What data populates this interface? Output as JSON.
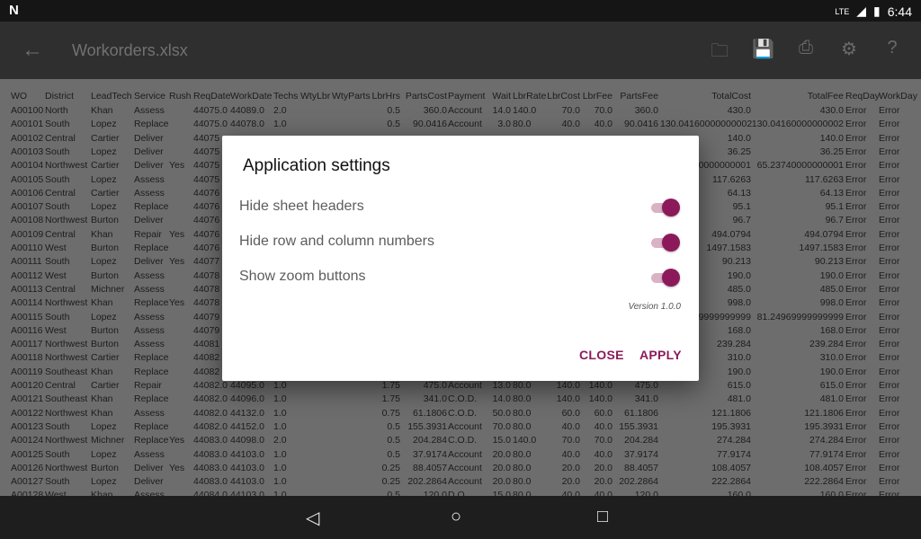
{
  "status_bar": {
    "time": "6:44",
    "network": "LTE",
    "notification_icon": "n-icon"
  },
  "app_bar": {
    "title": "Workorders.xlsx",
    "icons": [
      "back-arrow-icon",
      "folder-icon",
      "save-icon",
      "print-icon",
      "gear-icon",
      "help-icon"
    ]
  },
  "sheet": {
    "columns": [
      "WO",
      "District",
      "LeadTech",
      "Service",
      "Rush",
      "ReqDate",
      "WorkDate",
      "Techs",
      "WtyLbr",
      "WtyParts",
      "LbrHrs",
      "PartsCost",
      "Payment",
      "Wait",
      "LbrRate",
      "LbrCost",
      "LbrFee",
      "PartsFee",
      "TotalCost",
      "TotalFee",
      "ReqDay",
      "WorkDay"
    ],
    "rows": [
      [
        "A00100",
        "North",
        "Khan",
        "Assess",
        "",
        "44075.0",
        "44089.0",
        "2.0",
        "",
        "",
        "0.5",
        "360.0",
        "Account",
        "14.0",
        "140.0",
        "70.0",
        "70.0",
        "360.0",
        "430.0",
        "430.0",
        "Error",
        "Error"
      ],
      [
        "A00101",
        "South",
        "Lopez",
        "Replace",
        "",
        "44075.0",
        "44078.0",
        "1.0",
        "",
        "",
        "0.5",
        "90.0416",
        "Account",
        "3.0",
        "80.0",
        "40.0",
        "40.0",
        "90.0416",
        "130.04160000000002",
        "130.04160000000002",
        "Error",
        "Error"
      ],
      [
        "A00102",
        "Central",
        "Cartier",
        "Deliver",
        "",
        "44075",
        "",
        "",
        "",
        "",
        "",
        "",
        "",
        "",
        "",
        "",
        "",
        "",
        "140.0",
        "140.0",
        "Error",
        "Error"
      ],
      [
        "A00103",
        "South",
        "Lopez",
        "Deliver",
        "",
        "44075",
        "",
        "",
        "",
        "",
        "",
        "",
        "",
        "",
        "",
        "",
        "",
        "",
        "36.25",
        "36.25",
        "Error",
        "Error"
      ],
      [
        "A00104",
        "Northwest",
        "Cartier",
        "Deliver",
        "Yes",
        "44075",
        "",
        "",
        "",
        "",
        "",
        "",
        "",
        "",
        "",
        "",
        "",
        "",
        "65.23740000000001",
        "65.23740000000001",
        "Error",
        "Error"
      ],
      [
        "A00105",
        "South",
        "Lopez",
        "Assess",
        "",
        "44075",
        "",
        "",
        "",
        "",
        "",
        "",
        "",
        "",
        "",
        "",
        "",
        "",
        "117.6263",
        "117.6263",
        "Error",
        "Error"
      ],
      [
        "A00106",
        "Central",
        "Cartier",
        "Assess",
        "",
        "44076",
        "",
        "",
        "",
        "",
        "",
        "",
        "",
        "",
        "",
        "",
        "",
        "",
        "64.13",
        "64.13",
        "Error",
        "Error"
      ],
      [
        "A00107",
        "South",
        "Lopez",
        "Replace",
        "",
        "44076",
        "",
        "",
        "",
        "",
        "",
        "",
        "",
        "",
        "",
        "",
        "",
        "",
        "95.1",
        "95.1",
        "Error",
        "Error"
      ],
      [
        "A00108",
        "Northwest",
        "Burton",
        "Deliver",
        "",
        "44076",
        "",
        "",
        "",
        "",
        "",
        "",
        "",
        "",
        "",
        "",
        "",
        "",
        "96.7",
        "96.7",
        "Error",
        "Error"
      ],
      [
        "A00109",
        "Central",
        "Khan",
        "Repair",
        "Yes",
        "44076",
        "",
        "",
        "",
        "",
        "",
        "",
        "",
        "",
        "",
        "",
        "",
        "",
        "494.0794",
        "494.0794",
        "Error",
        "Error"
      ],
      [
        "A00110",
        "West",
        "Burton",
        "Replace",
        "",
        "44076",
        "",
        "",
        "",
        "",
        "",
        "",
        "",
        "",
        "",
        "",
        "",
        "",
        "1497.1583",
        "1497.1583",
        "Error",
        "Error"
      ],
      [
        "A00111",
        "South",
        "Lopez",
        "Deliver",
        "Yes",
        "44077",
        "",
        "",
        "",
        "",
        "",
        "",
        "",
        "",
        "",
        "",
        "",
        "",
        "90.213",
        "90.213",
        "Error",
        "Error"
      ],
      [
        "A00112",
        "West",
        "Burton",
        "Assess",
        "",
        "44078",
        "",
        "",
        "",
        "",
        "",
        "",
        "",
        "",
        "",
        "",
        "",
        "",
        "190.0",
        "190.0",
        "Error",
        "Error"
      ],
      [
        "A00113",
        "Central",
        "Michner",
        "Assess",
        "",
        "44078",
        "",
        "",
        "",
        "",
        "",
        "",
        "",
        "",
        "",
        "",
        "",
        "",
        "485.0",
        "485.0",
        "Error",
        "Error"
      ],
      [
        "A00114",
        "Northwest",
        "Khan",
        "Replace",
        "Yes",
        "44078",
        "",
        "",
        "",
        "",
        "",
        "",
        "",
        "",
        "",
        "",
        "",
        "",
        "998.0",
        "998.0",
        "Error",
        "Error"
      ],
      [
        "A00115",
        "South",
        "Lopez",
        "Assess",
        "",
        "44079",
        "",
        "",
        "",
        "",
        "",
        "",
        "",
        "",
        "",
        "",
        "",
        "",
        "81.24969999999999",
        "81.24969999999999",
        "Error",
        "Error"
      ],
      [
        "A00116",
        "West",
        "Burton",
        "Assess",
        "",
        "44079",
        "",
        "",
        "",
        "",
        "",
        "",
        "",
        "",
        "",
        "",
        "",
        "",
        "168.0",
        "168.0",
        "Error",
        "Error"
      ],
      [
        "A00117",
        "Northwest",
        "Burton",
        "Assess",
        "",
        "44081",
        "",
        "",
        "",
        "",
        "",
        "",
        "",
        "",
        "",
        "",
        "",
        "",
        "239.284",
        "239.284",
        "Error",
        "Error"
      ],
      [
        "A00118",
        "Northwest",
        "Cartier",
        "Replace",
        "",
        "44082",
        "",
        "",
        "",
        "",
        "",
        "",
        "",
        "",
        "",
        "",
        "",
        "",
        "310.0",
        "310.0",
        "Error",
        "Error"
      ],
      [
        "A00119",
        "Southeast",
        "Khan",
        "Replace",
        "",
        "44082",
        "",
        "",
        "",
        "",
        "",
        "",
        "",
        "",
        "",
        "",
        "",
        "",
        "190.0",
        "190.0",
        "Error",
        "Error"
      ],
      [
        "A00120",
        "Central",
        "Cartier",
        "Repair",
        "",
        "44082.0",
        "44095.0",
        "1.0",
        "",
        "",
        "1.75",
        "475.0",
        "Account",
        "13.0",
        "80.0",
        "140.0",
        "140.0",
        "475.0",
        "615.0",
        "615.0",
        "Error",
        "Error"
      ],
      [
        "A00121",
        "Southeast",
        "Khan",
        "Replace",
        "",
        "44082.0",
        "44096.0",
        "1.0",
        "",
        "",
        "1.75",
        "341.0",
        "C.O.D.",
        "14.0",
        "80.0",
        "140.0",
        "140.0",
        "341.0",
        "481.0",
        "481.0",
        "Error",
        "Error"
      ],
      [
        "A00122",
        "Northwest",
        "Khan",
        "Assess",
        "",
        "44082.0",
        "44132.0",
        "1.0",
        "",
        "",
        "0.75",
        "61.1806",
        "C.O.D.",
        "50.0",
        "80.0",
        "60.0",
        "60.0",
        "61.1806",
        "121.1806",
        "121.1806",
        "Error",
        "Error"
      ],
      [
        "A00123",
        "South",
        "Lopez",
        "Replace",
        "",
        "44082.0",
        "44152.0",
        "1.0",
        "",
        "",
        "0.5",
        "155.3931",
        "Account",
        "70.0",
        "80.0",
        "40.0",
        "40.0",
        "155.3931",
        "195.3931",
        "195.3931",
        "Error",
        "Error"
      ],
      [
        "A00124",
        "Northwest",
        "Michner",
        "Replace",
        "Yes",
        "44083.0",
        "44098.0",
        "2.0",
        "",
        "",
        "0.5",
        "204.284",
        "C.O.D.",
        "15.0",
        "140.0",
        "70.0",
        "70.0",
        "204.284",
        "274.284",
        "274.284",
        "Error",
        "Error"
      ],
      [
        "A00125",
        "South",
        "Lopez",
        "Assess",
        "",
        "44083.0",
        "44103.0",
        "1.0",
        "",
        "",
        "0.5",
        "37.9174",
        "Account",
        "20.0",
        "80.0",
        "40.0",
        "40.0",
        "37.9174",
        "77.9174",
        "77.9174",
        "Error",
        "Error"
      ],
      [
        "A00126",
        "Northwest",
        "Burton",
        "Deliver",
        "Yes",
        "44083.0",
        "44103.0",
        "1.0",
        "",
        "",
        "0.25",
        "88.4057",
        "Account",
        "20.0",
        "80.0",
        "20.0",
        "20.0",
        "88.4057",
        "108.4057",
        "108.4057",
        "Error",
        "Error"
      ],
      [
        "A00127",
        "South",
        "Lopez",
        "Deliver",
        "",
        "44083.0",
        "44103.0",
        "1.0",
        "",
        "",
        "0.25",
        "202.2864",
        "Account",
        "20.0",
        "80.0",
        "20.0",
        "20.0",
        "202.2864",
        "222.2864",
        "222.2864",
        "Error",
        "Error"
      ],
      [
        "A00128",
        "West",
        "Khan",
        "Assess",
        "",
        "44084.0",
        "44103.0",
        "1.0",
        "",
        "",
        "0.5",
        "120.0",
        "D.O.",
        "15.0",
        "80.0",
        "40.0",
        "40.0",
        "120.0",
        "160.0",
        "160.0",
        "Error",
        "Error"
      ]
    ]
  },
  "dialog": {
    "title": "Application settings",
    "settings": [
      {
        "label": "Hide sheet headers",
        "on": true
      },
      {
        "label": "Hide row and column numbers",
        "on": true
      },
      {
        "label": "Show zoom buttons",
        "on": true
      }
    ],
    "version": "Version 1.0.0",
    "close_label": "CLOSE",
    "apply_label": "APPLY"
  },
  "accent_color": "#8c1a5b",
  "nav_bar": {
    "icons": [
      "back-triangle-icon",
      "home-circle-icon",
      "recents-square-icon"
    ]
  }
}
